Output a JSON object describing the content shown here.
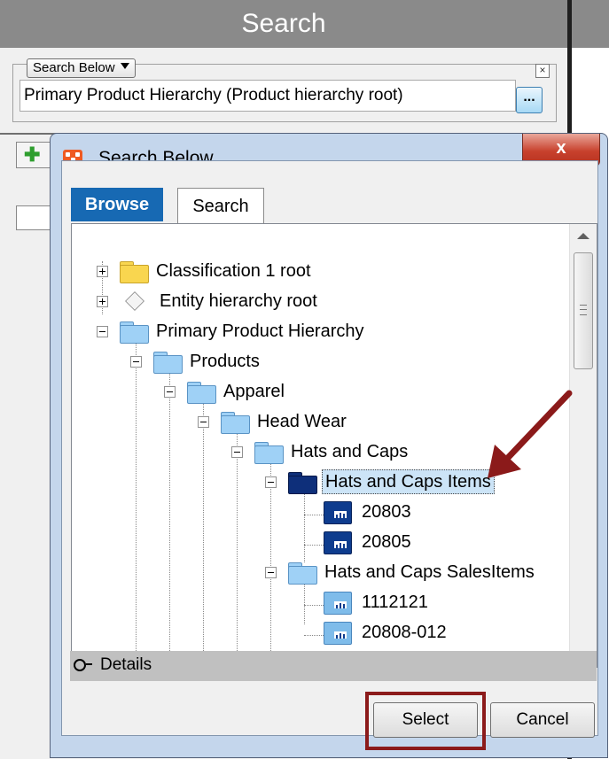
{
  "background": {
    "header_title": "Search",
    "search_scope_dropdown": "Search Below",
    "path_value": "Primary Product Hierarchy (Product hierarchy root)",
    "browse_button": "...",
    "close_small": "×",
    "add_button_icon": "plus-icon"
  },
  "dialog": {
    "title": "Search Below...",
    "close_label": "x",
    "tabs": [
      {
        "label": "Browse",
        "active": true
      },
      {
        "label": "Search",
        "active": false
      }
    ],
    "tree": [
      {
        "label": "Classification 1 root",
        "icon": "yellow-folder-icon",
        "expander": "plus"
      },
      {
        "label": "Entity hierarchy root",
        "icon": "cube-icon",
        "expander": "plus"
      },
      {
        "label": "Primary Product Hierarchy",
        "icon": "blue-folder-icon",
        "expander": "minus"
      },
      {
        "label": "Products",
        "icon": "blue-folder-icon",
        "expander": "minus"
      },
      {
        "label": "Apparel",
        "icon": "blue-folder-icon",
        "expander": "minus"
      },
      {
        "label": "Head Wear",
        "icon": "blue-folder-icon",
        "expander": "minus"
      },
      {
        "label": "Hats and Caps",
        "icon": "blue-folder-icon",
        "expander": "minus"
      },
      {
        "label": "Hats and Caps Items",
        "icon": "navy-folder-icon",
        "expander": "minus",
        "selected": true
      },
      {
        "label": "20803",
        "icon": "product-item-icon"
      },
      {
        "label": "20805",
        "icon": "product-item-icon"
      },
      {
        "label": "Hats and Caps SalesItems",
        "icon": "blue-folder-icon",
        "expander": "minus"
      },
      {
        "label": "1112121",
        "icon": "product-item-icon"
      },
      {
        "label": "20808-012",
        "icon": "product-item-icon"
      }
    ],
    "details_label": "Details",
    "buttons": {
      "select": "Select",
      "cancel": "Cancel"
    },
    "annotation_color": "#8b1a1a"
  }
}
